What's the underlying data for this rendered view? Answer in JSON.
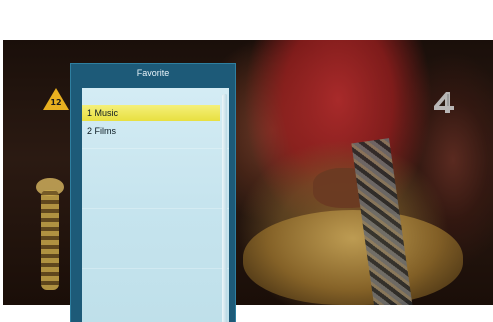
{
  "osd": {
    "title": "Favorite",
    "items": [
      {
        "label": "1 Music",
        "selected": true
      },
      {
        "label": "2 Films",
        "selected": false
      }
    ],
    "scroll_position": 0
  },
  "video": {
    "rating": "12",
    "channel_logo": "4"
  },
  "colors": {
    "panel_frame": "#1d5a78",
    "list_background": "#c6e4ee",
    "selection": "#eee65a",
    "rating_badge": "#e8b020",
    "channel_logo": "#c8c8c8"
  },
  "icons": [
    "age-rating-icon",
    "channel-4-logo-icon"
  ]
}
